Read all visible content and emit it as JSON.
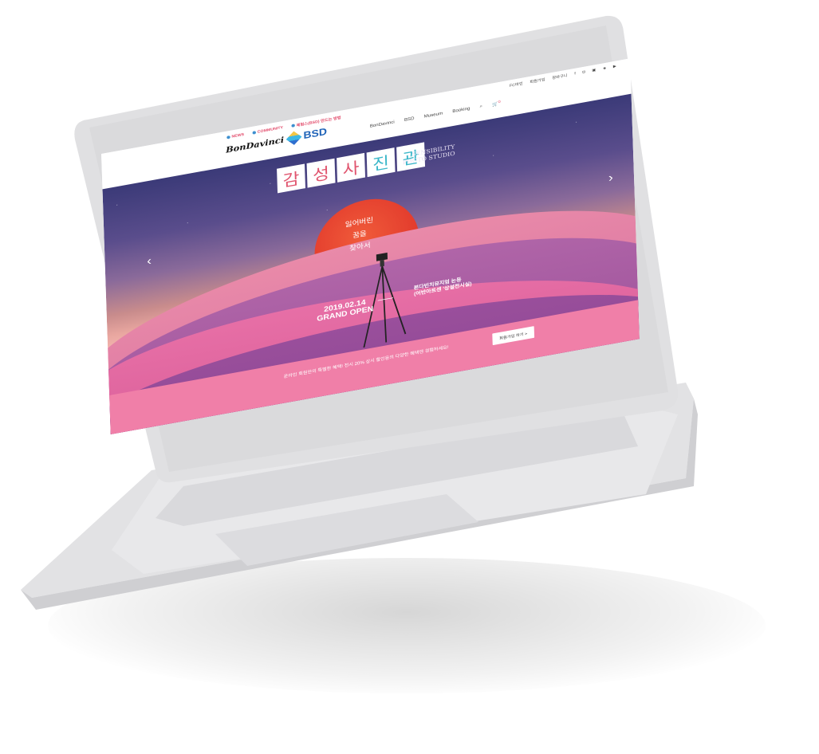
{
  "header": {
    "top_links": [
      "NEWS",
      "COMMUNITY",
      "체험스(BSD) 만드는 방법"
    ],
    "util_links": [
      "FC마인",
      "회원가입",
      "장바구니"
    ],
    "logo_text": "BonDavinci",
    "logo_sub": "BSD",
    "nav": [
      "BonDavinci",
      "BSD",
      "Museum",
      "Booking"
    ],
    "cart_count": "0"
  },
  "hero": {
    "title_chars": [
      "감",
      "성",
      "사",
      "진",
      "관"
    ],
    "title_colors": [
      "#e0546e",
      "#e0546e",
      "#e0546e",
      "#3ab7c9",
      "#3ab7c9"
    ],
    "subtitle_en_1": "SENSIBILITY",
    "subtitle_en_2": "PHOTO STUDIO",
    "poem": [
      "잃어버린",
      "꿈을",
      "찾아서"
    ],
    "date": "2019.02.14",
    "grand_open": "GRAND OPEN",
    "museum_line1": "본다빈치뮤지엄 논등",
    "museum_line2": "(어반아트센 '상설전시실)",
    "promo": "온라인 회원만의 특별한 혜택! 전시 20% 상시 할인등의 다양한 혜택엔 경험하세요!",
    "cta": "회원가입 하기 >"
  }
}
